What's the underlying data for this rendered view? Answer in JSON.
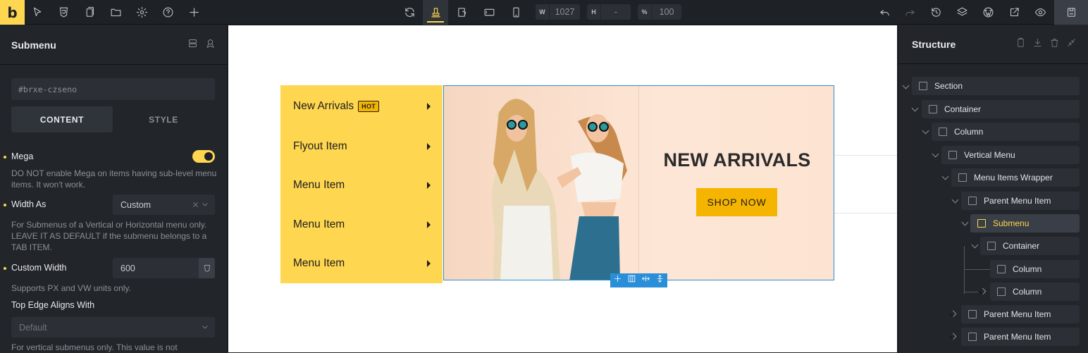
{
  "topbar": {
    "logo": "b",
    "left_icons": [
      "cursor-icon",
      "css3-icon",
      "pages-icon",
      "folder-icon",
      "settings-icon",
      "help-icon",
      "plus-icon"
    ],
    "center_icons": [
      "refresh-icon",
      "desktop-preview-icon",
      "tablet-landscape-icon",
      "tablet-icon",
      "mobile-icon"
    ],
    "width": {
      "label": "W",
      "value": "1027"
    },
    "height": {
      "label": "H",
      "value": "-"
    },
    "scale": {
      "label": "%",
      "value": "100"
    },
    "right_icons": [
      "undo-icon",
      "redo-icon",
      "history-icon",
      "layers-icon",
      "wordpress-icon",
      "external-link-icon",
      "preview-eye-icon",
      "save-icon"
    ]
  },
  "left_panel": {
    "title": "Submenu",
    "css_id": "#brxe-czseno",
    "tabs": [
      "CONTENT",
      "STYLE"
    ],
    "mega": {
      "label": "Mega",
      "enabled": true,
      "description": "DO NOT enable Mega on items having sub-level menu items. It won't work."
    },
    "width_as": {
      "label": "Width As",
      "value": "Custom",
      "description": "For Submenus of a Vertical or Horizontal menu only. LEAVE IT AS DEFAULT if the submenu belongs to a TAB ITEM."
    },
    "custom_width": {
      "label": "Custom Width",
      "value": "600",
      "description": "Supports PX and VW units only."
    },
    "top_edge": {
      "label": "Top Edge Aligns With",
      "placeholder": "Default",
      "description": "For vertical submenus only. This value is not"
    }
  },
  "canvas": {
    "menu_items": [
      {
        "label": "New Arrivals",
        "badge": "HOT"
      },
      {
        "label": "Flyout Item"
      },
      {
        "label": "Menu Item"
      },
      {
        "label": "Menu Item"
      },
      {
        "label": "Menu Item"
      }
    ],
    "banner": {
      "heading": "NEW ARRIVALS",
      "button": "SHOP NOW"
    },
    "colors": {
      "menu_bg": "#ffd64f",
      "accent": "#f5b400",
      "selection": "#2a8fd8"
    }
  },
  "structure": {
    "title": "Structure",
    "items": [
      {
        "label": "Section",
        "depth": 0
      },
      {
        "label": "Container",
        "depth": 1
      },
      {
        "label": "Column",
        "depth": 2
      },
      {
        "label": "Vertical Menu",
        "depth": 3
      },
      {
        "label": "Menu Items Wrapper",
        "depth": 4
      },
      {
        "label": "Parent Menu Item",
        "depth": 5
      },
      {
        "label": "Submenu",
        "depth": 6,
        "active": true
      },
      {
        "label": "Container",
        "depth": 7
      },
      {
        "label": "Column",
        "depth": 8
      },
      {
        "label": "Column",
        "depth": 8
      },
      {
        "label": "Parent Menu Item",
        "depth": 5
      },
      {
        "label": "Parent Menu Item",
        "depth": 5
      }
    ]
  }
}
